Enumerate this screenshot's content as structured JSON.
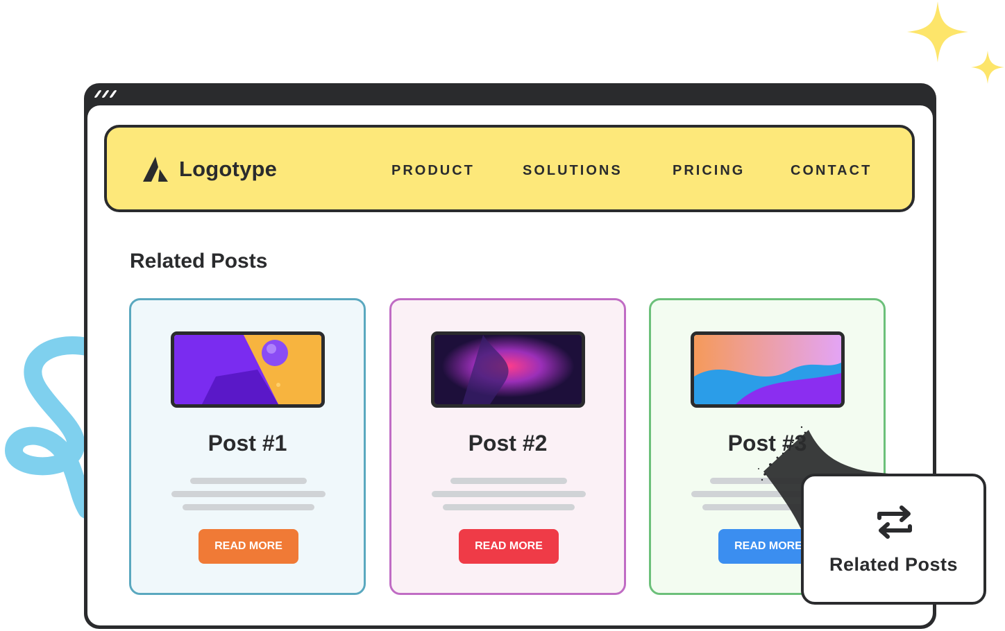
{
  "colors": {
    "frame": "#2a2b2d",
    "navbar_bg": "#fde87a",
    "card1_border": "#5aa8bf",
    "card1_bg": "#f0f8fb",
    "card2_border": "#c06cc4",
    "card2_bg": "#fbf1f6",
    "card3_border": "#6cc07a",
    "card3_bg": "#f3fcf1",
    "btn1": "#f07a36",
    "btn2": "#ef3b47",
    "btn3": "#3b8ef0"
  },
  "navbar": {
    "logo_icon": "logo-mark-icon",
    "logo_text": "Logotype",
    "items": [
      "PRODUCT",
      "SOLUTIONS",
      "PRICING",
      "CONTACT"
    ]
  },
  "section": {
    "title": "Related Posts"
  },
  "posts": [
    {
      "title": "Post #1",
      "button": "READ MORE"
    },
    {
      "title": "Post #2",
      "button": "READ MORE"
    },
    {
      "title": "Post #3",
      "button": "READ MORE"
    }
  ],
  "popup": {
    "icon": "repeat-arrows-icon",
    "label": "Related Posts"
  }
}
